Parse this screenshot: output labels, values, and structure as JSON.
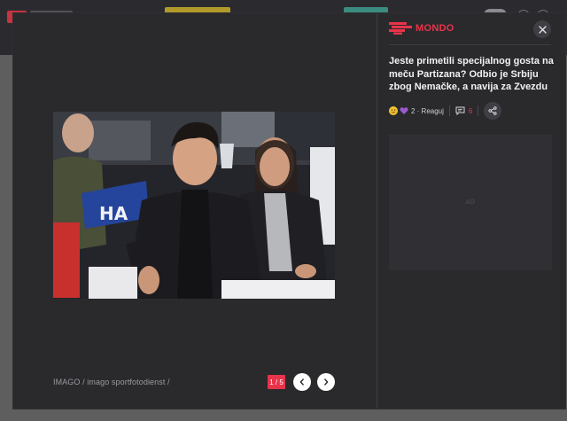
{
  "modal": {
    "brand_name": "MONDO",
    "headline": "Jeste primetili specijalnog gosta na meču Partizana? Odbio je Srbiju zbog Nemačke, a navija za Zvezdu",
    "reactions_text": "2 · Reaguj",
    "comments_count": "6",
    "ad_label": "AD",
    "photo_credit": "IMAGO / imago sportfotodienst /",
    "photo_counter": "1 / 5",
    "icons": {
      "close": "close-icon",
      "prev": "chevron-left-icon",
      "next": "chevron-right-icon",
      "share": "share-icon",
      "comment": "comment-icon",
      "reaction_emoji": "smile-emoji-icon",
      "reaction_heart": "purple-heart-icon"
    },
    "colors": {
      "accent": "#e8334a",
      "panel": "#2a2a2d",
      "overlay": "#5e5e5e"
    }
  }
}
